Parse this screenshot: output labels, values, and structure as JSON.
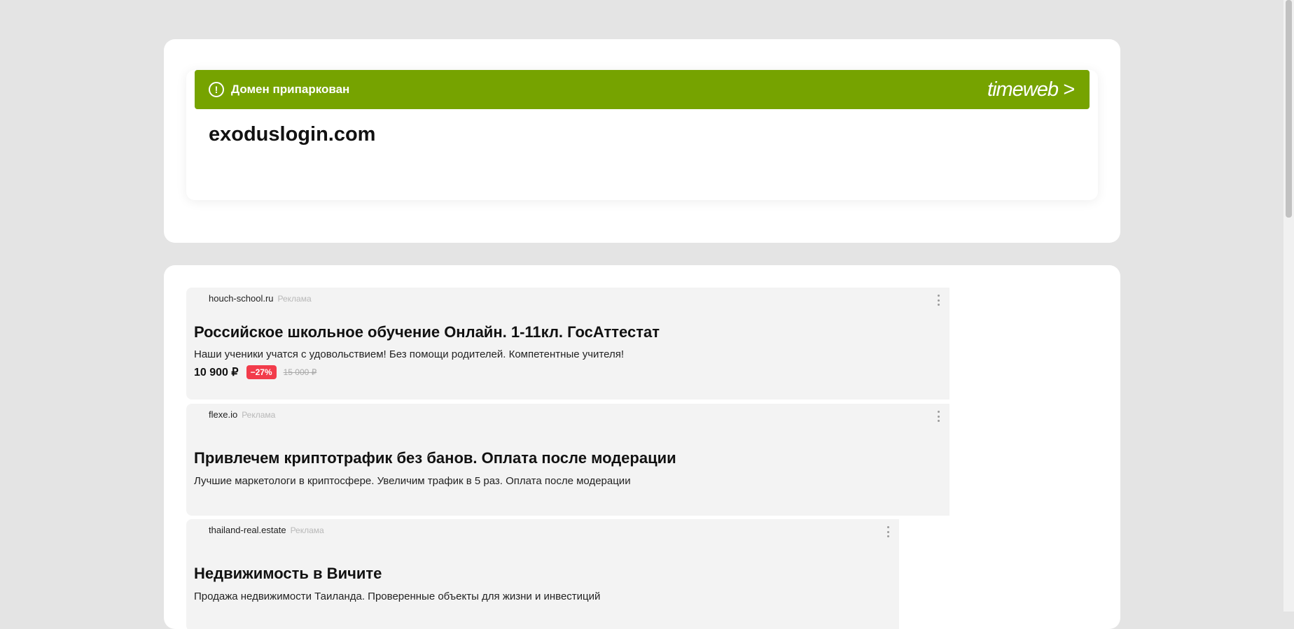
{
  "banner": {
    "text": "Домен припаркован",
    "brand": "timeweb >",
    "alert_icon": "!",
    "color": "#76a300"
  },
  "domain": "exoduslogin.com",
  "ads": [
    {
      "site": "houch-school.ru",
      "label": "Реклама",
      "title": "Российское школьное обучение Онлайн. 1-11кл. ГосАттестат",
      "description": "Наши ученики учатся с удовольствием! Без помощи родителей. Компетентные учителя!",
      "price": "10 900 ₽",
      "discount": "−27%",
      "old_price": "15 000 ₽"
    },
    {
      "site": "flexe.io",
      "label": "Реклама",
      "title": "Привлечем криптотрафик без банов. Оплата после модерации",
      "description": "Лучшие маркетологи в криптосфере. Увеличим трафик в 5 раз. Оплата после модерации"
    },
    {
      "site": "thailand-real.estate",
      "label": "Реклама",
      "title": "Недвижимость в Вичите",
      "description": "Продажа недвижимости Таиланда. Проверенные объекты для жизни и инвестиций"
    }
  ],
  "colors": {
    "discount": "#f23c4b",
    "ad_background": "#f3f3f3",
    "page_background": "#e4e4e4"
  }
}
